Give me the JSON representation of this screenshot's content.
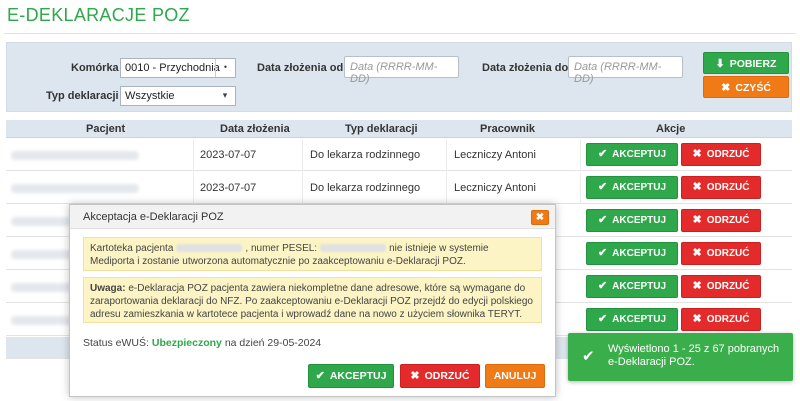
{
  "page": {
    "title": "E-DEKLARACJE POZ"
  },
  "filters": {
    "komorka_label": "Komórka",
    "komorka_value": "0010 - Przychodnia",
    "data_od_label": "Data złożenia od",
    "data_od_placeholder": "Data (RRRR-MM-DD)",
    "data_do_label": "Data złożenia do",
    "data_do_placeholder": "Data (RRRR-MM-DD)",
    "typ_label": "Typ deklaracji",
    "typ_value": "Wszystkie",
    "pobierz_label": "POBIERZ",
    "czysc_label": "CZYŚĆ"
  },
  "table": {
    "columns": [
      "Pacjent",
      "Data złożenia",
      "Typ deklaracji",
      "Pracownik",
      "Akcje"
    ],
    "rows": [
      {
        "data": "2023-07-07",
        "typ": "Do lekarza rodzinnego",
        "pracownik": "Leczniczy Antoni"
      },
      {
        "data": "2023-07-07",
        "typ": "Do lekarza rodzinnego",
        "pracownik": "Leczniczy Antoni"
      }
    ],
    "accept_label": "AKCEPTUJ",
    "reject_label": "ODRZUĆ"
  },
  "modal": {
    "title": "Akceptacja e-Deklaracji POZ",
    "note1_prefix": "Kartoteka pacjenta",
    "note1_mid": ", numer PESEL:",
    "note1_suffix": "nie istnieje w systemie Mediporta i zostanie utworzona automatycznie po zaakceptowaniu e-Deklaracji POZ.",
    "note2_bold": "Uwaga:",
    "note2_text": "e-Deklaracja POZ pacjenta zawiera niekompletne dane adresowe, które są wymagane do zaraportowania deklaracji do NFZ. Po zaakceptowaniu e-Deklaracji POZ przejdź do edycji polskiego adresu zamieszkania w kartotece pacjenta i wprowadź dane na nowo z użyciem słownika TERYT.",
    "status_label": "Status eWUŚ:",
    "status_value": "Ubezpieczony",
    "status_date": "na dzień 29-05-2024",
    "accept_label": "AKCEPTUJ",
    "reject_label": "ODRZUĆ",
    "cancel_label": "ANULUJ"
  },
  "toast": {
    "text": "Wyświetlono 1 - 25 z 67 pobranych e-Deklaracji POZ."
  },
  "colors": {
    "green": "#2ea84b",
    "orange": "#f07a16",
    "red": "#e32b2b",
    "note_bg": "#fcf4c4"
  },
  "icons": [
    "download-icon",
    "clear-icon",
    "check-icon",
    "x-icon",
    "close-icon",
    "dropdown-arrow-icon"
  ]
}
